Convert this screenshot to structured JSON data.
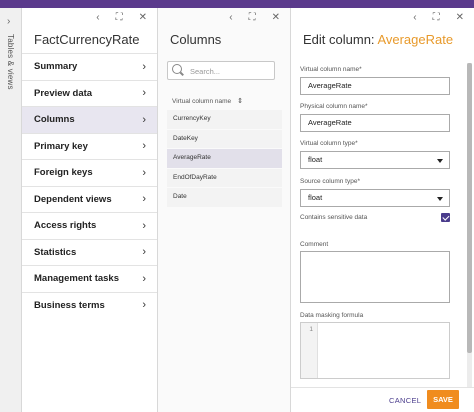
{
  "rail": {
    "label": "Tables & views",
    "chevron": "›"
  },
  "controls": {
    "back": "‹",
    "expand": "⛶",
    "close": "✕"
  },
  "panel1": {
    "title": "FactCurrencyRate",
    "nav": [
      {
        "label": "Summary",
        "active": false
      },
      {
        "label": "Preview data",
        "active": false
      },
      {
        "label": "Columns",
        "active": true
      },
      {
        "label": "Primary key",
        "active": false
      },
      {
        "label": "Foreign keys",
        "active": false
      },
      {
        "label": "Dependent views",
        "active": false
      },
      {
        "label": "Access rights",
        "active": false
      },
      {
        "label": "Statistics",
        "active": false
      },
      {
        "label": "Management tasks",
        "active": false
      },
      {
        "label": "Business terms",
        "active": false
      }
    ]
  },
  "panel2": {
    "title": "Columns",
    "search_placeholder": "Search...",
    "column_header": "Virtual column name",
    "sort_icon": "⇕",
    "columns": [
      {
        "name": "CurrencyKey",
        "active": false
      },
      {
        "name": "DateKey",
        "active": false
      },
      {
        "name": "AverageRate",
        "active": true
      },
      {
        "name": "EndOfDayRate",
        "active": false
      },
      {
        "name": "Date",
        "active": false
      }
    ]
  },
  "panel3": {
    "title_prefix": "Edit column: ",
    "title_name": "AverageRate",
    "virtual_name_label": "Virtual column name*",
    "virtual_name_value": "AverageRate",
    "physical_name_label": "Physical column name*",
    "physical_name_value": "AverageRate",
    "virtual_type_label": "Virtual column type*",
    "virtual_type_value": "float",
    "source_type_label": "Source column type*",
    "source_type_value": "float",
    "sensitive_label": "Contains sensitive data",
    "sensitive_checked": true,
    "comment_label": "Comment",
    "masking_label": "Data masking formula",
    "line_number": "1",
    "cancel_label": "CANCEL",
    "save_label": "SAVE"
  },
  "colors": {
    "accent": "#e89a2b",
    "primary": "#4a3c8c",
    "save": "#f08c1e",
    "topbar": "#5b3a8c"
  }
}
